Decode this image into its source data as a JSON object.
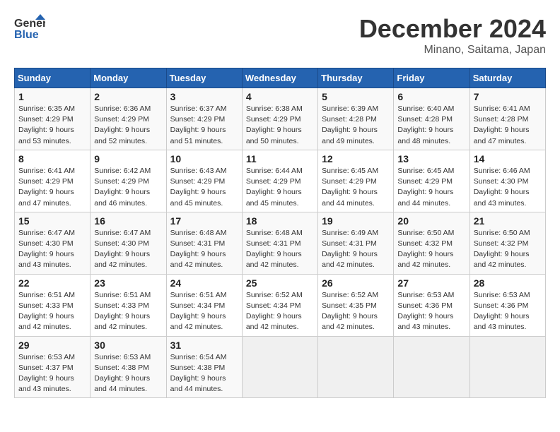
{
  "header": {
    "logo_line1": "General",
    "logo_line2": "Blue",
    "main_title": "December 2024",
    "subtitle": "Minano, Saitama, Japan"
  },
  "weekdays": [
    "Sunday",
    "Monday",
    "Tuesday",
    "Wednesday",
    "Thursday",
    "Friday",
    "Saturday"
  ],
  "weeks": [
    [
      {
        "day": "1",
        "sunrise": "6:35 AM",
        "sunset": "4:29 PM",
        "daylight": "9 hours and 53 minutes."
      },
      {
        "day": "2",
        "sunrise": "6:36 AM",
        "sunset": "4:29 PM",
        "daylight": "9 hours and 52 minutes."
      },
      {
        "day": "3",
        "sunrise": "6:37 AM",
        "sunset": "4:29 PM",
        "daylight": "9 hours and 51 minutes."
      },
      {
        "day": "4",
        "sunrise": "6:38 AM",
        "sunset": "4:29 PM",
        "daylight": "9 hours and 50 minutes."
      },
      {
        "day": "5",
        "sunrise": "6:39 AM",
        "sunset": "4:28 PM",
        "daylight": "9 hours and 49 minutes."
      },
      {
        "day": "6",
        "sunrise": "6:40 AM",
        "sunset": "4:28 PM",
        "daylight": "9 hours and 48 minutes."
      },
      {
        "day": "7",
        "sunrise": "6:41 AM",
        "sunset": "4:28 PM",
        "daylight": "9 hours and 47 minutes."
      }
    ],
    [
      {
        "day": "8",
        "sunrise": "6:41 AM",
        "sunset": "4:29 PM",
        "daylight": "9 hours and 47 minutes."
      },
      {
        "day": "9",
        "sunrise": "6:42 AM",
        "sunset": "4:29 PM",
        "daylight": "9 hours and 46 minutes."
      },
      {
        "day": "10",
        "sunrise": "6:43 AM",
        "sunset": "4:29 PM",
        "daylight": "9 hours and 45 minutes."
      },
      {
        "day": "11",
        "sunrise": "6:44 AM",
        "sunset": "4:29 PM",
        "daylight": "9 hours and 45 minutes."
      },
      {
        "day": "12",
        "sunrise": "6:45 AM",
        "sunset": "4:29 PM",
        "daylight": "9 hours and 44 minutes."
      },
      {
        "day": "13",
        "sunrise": "6:45 AM",
        "sunset": "4:29 PM",
        "daylight": "9 hours and 44 minutes."
      },
      {
        "day": "14",
        "sunrise": "6:46 AM",
        "sunset": "4:30 PM",
        "daylight": "9 hours and 43 minutes."
      }
    ],
    [
      {
        "day": "15",
        "sunrise": "6:47 AM",
        "sunset": "4:30 PM",
        "daylight": "9 hours and 43 minutes."
      },
      {
        "day": "16",
        "sunrise": "6:47 AM",
        "sunset": "4:30 PM",
        "daylight": "9 hours and 42 minutes."
      },
      {
        "day": "17",
        "sunrise": "6:48 AM",
        "sunset": "4:31 PM",
        "daylight": "9 hours and 42 minutes."
      },
      {
        "day": "18",
        "sunrise": "6:48 AM",
        "sunset": "4:31 PM",
        "daylight": "9 hours and 42 minutes."
      },
      {
        "day": "19",
        "sunrise": "6:49 AM",
        "sunset": "4:31 PM",
        "daylight": "9 hours and 42 minutes."
      },
      {
        "day": "20",
        "sunrise": "6:50 AM",
        "sunset": "4:32 PM",
        "daylight": "9 hours and 42 minutes."
      },
      {
        "day": "21",
        "sunrise": "6:50 AM",
        "sunset": "4:32 PM",
        "daylight": "9 hours and 42 minutes."
      }
    ],
    [
      {
        "day": "22",
        "sunrise": "6:51 AM",
        "sunset": "4:33 PM",
        "daylight": "9 hours and 42 minutes."
      },
      {
        "day": "23",
        "sunrise": "6:51 AM",
        "sunset": "4:33 PM",
        "daylight": "9 hours and 42 minutes."
      },
      {
        "day": "24",
        "sunrise": "6:51 AM",
        "sunset": "4:34 PM",
        "daylight": "9 hours and 42 minutes."
      },
      {
        "day": "25",
        "sunrise": "6:52 AM",
        "sunset": "4:34 PM",
        "daylight": "9 hours and 42 minutes."
      },
      {
        "day": "26",
        "sunrise": "6:52 AM",
        "sunset": "4:35 PM",
        "daylight": "9 hours and 42 minutes."
      },
      {
        "day": "27",
        "sunrise": "6:53 AM",
        "sunset": "4:36 PM",
        "daylight": "9 hours and 43 minutes."
      },
      {
        "day": "28",
        "sunrise": "6:53 AM",
        "sunset": "4:36 PM",
        "daylight": "9 hours and 43 minutes."
      }
    ],
    [
      {
        "day": "29",
        "sunrise": "6:53 AM",
        "sunset": "4:37 PM",
        "daylight": "9 hours and 43 minutes."
      },
      {
        "day": "30",
        "sunrise": "6:53 AM",
        "sunset": "4:38 PM",
        "daylight": "9 hours and 44 minutes."
      },
      {
        "day": "31",
        "sunrise": "6:54 AM",
        "sunset": "4:38 PM",
        "daylight": "9 hours and 44 minutes."
      },
      null,
      null,
      null,
      null
    ]
  ],
  "labels": {
    "sunrise": "Sunrise:",
    "sunset": "Sunset:",
    "daylight": "Daylight:"
  }
}
